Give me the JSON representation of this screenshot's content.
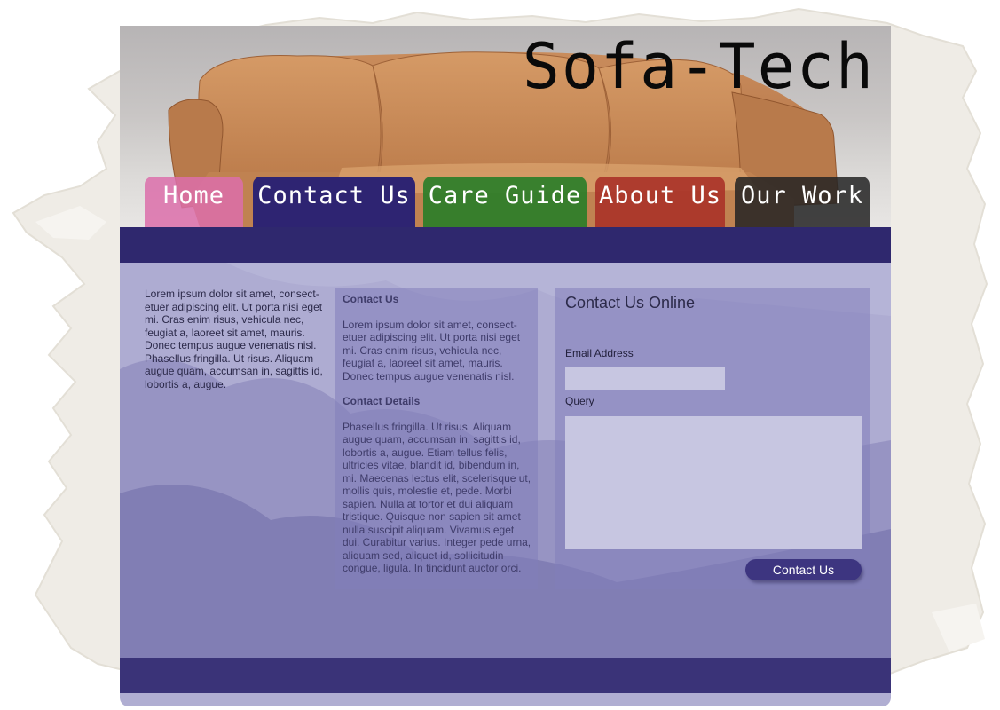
{
  "site": {
    "title": "Sofa-Tech"
  },
  "nav": {
    "items": [
      {
        "label": "Home",
        "color": "#dc6eaa"
      },
      {
        "label": "Contact Us",
        "color": "#2e2472"
      },
      {
        "label": "Care Guide",
        "color": "#287d28"
      },
      {
        "label": "About Us",
        "color": "#aa3228"
      },
      {
        "label": "Our Work",
        "color": "#232323"
      }
    ]
  },
  "intro": {
    "text": "Lorem ipsum dolor sit amet, consect-etuer adipiscing elit. Ut porta nisi eget mi. Cras enim risus, vehicula nec, feugiat a, laoreet sit amet, mauris. Donec tempus augue venenatis nisl. Phasellus fringilla. Ut risus. Aliquam augue quam, accumsan in, sagittis id, lobortis a, augue."
  },
  "contact_info": {
    "heading": "Contact Us",
    "paragraph": "Lorem ipsum dolor sit amet, consect-etuer adipiscing elit. Ut porta nisi eget mi. Cras enim risus, vehicula nec, feugiat a, laoreet sit amet, mauris. Donec tempus augue venenatis nisl.",
    "details_heading": "Contact Details",
    "details": "Phasellus fringilla. Ut risus. Aliquam augue quam, accumsan in, sagittis id, lobortis a, augue. Etiam tellus felis, ultricies vitae, blandit id, bibendum in, mi. Maecenas lectus elit, scelerisque ut, mollis quis, molestie et, pede. Morbi sapien. Nulla at tortor et dui aliquam tristique. Quisque non sapien sit amet nulla suscipit aliquam. Vivamus eget dui. Curabitur varius. Integer pede urna, aliquam sed, aliquet id, sollicitudin congue, ligula. In tincidunt auctor orci."
  },
  "form": {
    "title": "Contact Us Online",
    "email_label": "Email Address",
    "email_value": "",
    "query_label": "Query",
    "query_value": "",
    "submit_label": "Contact Us"
  },
  "colors": {
    "band": "#2f286e",
    "panel": "#a09ecd",
    "input": "#c7c6e1"
  }
}
